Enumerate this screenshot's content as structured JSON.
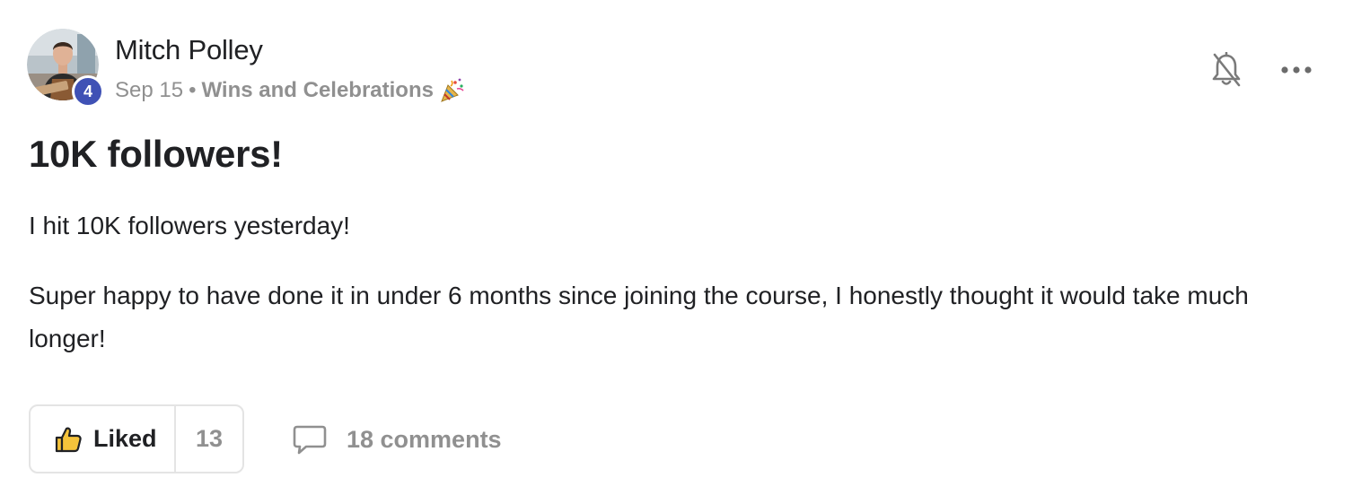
{
  "post": {
    "author": {
      "name": "Mitch Polley",
      "level": "4",
      "avatar": "avatar-photo"
    },
    "meta": {
      "date": "Sep 15",
      "separator": "•",
      "category": "Wins and Celebrations",
      "category_icon": "party-popper-icon"
    },
    "title": "10K followers!",
    "body": [
      "I hit 10K followers yesterday!",
      "Super happy to have done it in under 6 months since joining the course, I honestly thought it would take much longer!"
    ],
    "actions": {
      "like_label": "Liked",
      "like_count": "13",
      "comments_label": "18 comments"
    },
    "icons": {
      "notification": "bell-off-icon",
      "more": "more-horizontal-icon",
      "like": "thumbs-up-icon",
      "comment": "comment-icon"
    },
    "colors": {
      "level_badge": "#3f51b5",
      "muted_text": "#909090",
      "primary_text": "#202124",
      "border": "#e4e4e4",
      "like_icon": "#f5c33b"
    }
  }
}
